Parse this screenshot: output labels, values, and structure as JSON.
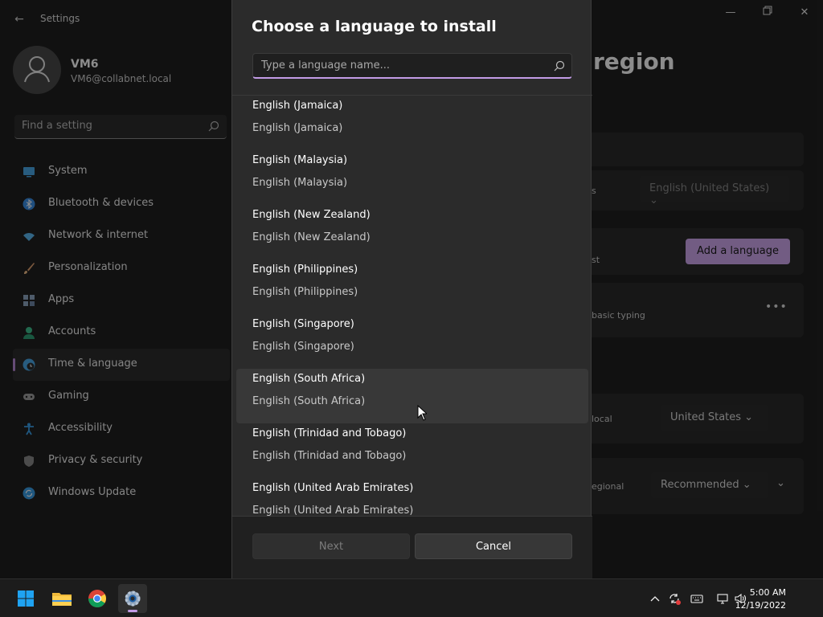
{
  "settings": {
    "app_title": "Settings",
    "user": {
      "name": "VM6",
      "email": "VM6@collabnet.local"
    },
    "search_placeholder": "Find a setting",
    "nav": [
      {
        "label": "System",
        "icon": "monitor-icon",
        "color": "#4aa8e8"
      },
      {
        "label": "Bluetooth & devices",
        "icon": "bluetooth-icon",
        "color": "#3a8ee6"
      },
      {
        "label": "Network & internet",
        "icon": "wifi-icon",
        "color": "#5cb8f0"
      },
      {
        "label": "Personalization",
        "icon": "brush-icon",
        "color": "#e0a070"
      },
      {
        "label": "Apps",
        "icon": "apps-icon",
        "color": "#8fa6c2"
      },
      {
        "label": "Accounts",
        "icon": "person-icon",
        "color": "#3fbf8f"
      },
      {
        "label": "Time & language",
        "icon": "globe-clock-icon",
        "color": "#4aa8e8"
      },
      {
        "label": "Gaming",
        "icon": "gamepad-icon",
        "color": "#a0a0a0"
      },
      {
        "label": "Accessibility",
        "icon": "accessibility-icon",
        "color": "#3a9ee8"
      },
      {
        "label": "Privacy & security",
        "icon": "shield-icon",
        "color": "#a0a0a0"
      },
      {
        "label": "Windows Update",
        "icon": "update-icon",
        "color": "#3a9ee8"
      }
    ],
    "active_nav_index": 6,
    "page_title": "region",
    "background_text": {
      "display_suffix": "s",
      "display_language": "English (United States)",
      "preferred_suffix": "st",
      "add_language": "Add a language",
      "typing_text": "basic typing",
      "more": "•••",
      "region_suffix": "local",
      "country": "United States",
      "format_suffix": "egional",
      "format": "Recommended"
    }
  },
  "dialog": {
    "title": "Choose a language to install",
    "search_placeholder": "Type a language name...",
    "languages": [
      {
        "name": "English (Jamaica)",
        "native": "English (Jamaica)"
      },
      {
        "name": "English (Malaysia)",
        "native": "English (Malaysia)"
      },
      {
        "name": "English (New Zealand)",
        "native": "English (New Zealand)"
      },
      {
        "name": "English (Philippines)",
        "native": "English (Philippines)"
      },
      {
        "name": "English (Singapore)",
        "native": "English (Singapore)"
      },
      {
        "name": "English (South Africa)",
        "native": "English (South Africa)"
      },
      {
        "name": "English (Trinidad and Tobago)",
        "native": "English (Trinidad and Tobago)"
      },
      {
        "name": "English (United Arab Emirates)",
        "native": "English (United Arab Emirates)"
      }
    ],
    "hovered_index": 5,
    "next_label": "Next",
    "cancel_label": "Cancel"
  },
  "taskbar": {
    "apps": [
      "start-icon",
      "file-explorer-icon",
      "chrome-icon",
      "settings-icon"
    ],
    "time": "5:00 AM",
    "date": "12/19/2022"
  },
  "colors": {
    "accent": "#c29be6",
    "accent_button": "#cfa8ef"
  }
}
